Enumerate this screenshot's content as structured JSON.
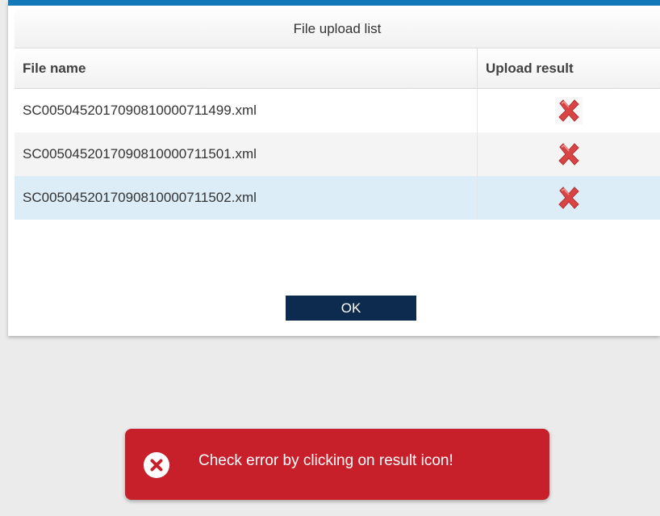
{
  "dialog": {
    "title": "File upload list",
    "accent_color": "#1479b8",
    "columns": {
      "file_name": "File name",
      "upload_result": "Upload result"
    },
    "rows": [
      {
        "file_name": "SC005045201709081000071149­9.xml",
        "result_icon": "error-x-icon"
      },
      {
        "file_name": "SC0050452017090810000711501.xml",
        "result_icon": "error-x-icon"
      },
      {
        "file_name": "SC0050452017090810000711502.xml",
        "result_icon": "error-x-icon"
      }
    ],
    "ok_label": "OK",
    "ok_color": "#0d2b4e"
  },
  "toast": {
    "message": "Check error by clicking on result icon!",
    "icon": "error-circle-icon",
    "background": "#c8202a"
  }
}
